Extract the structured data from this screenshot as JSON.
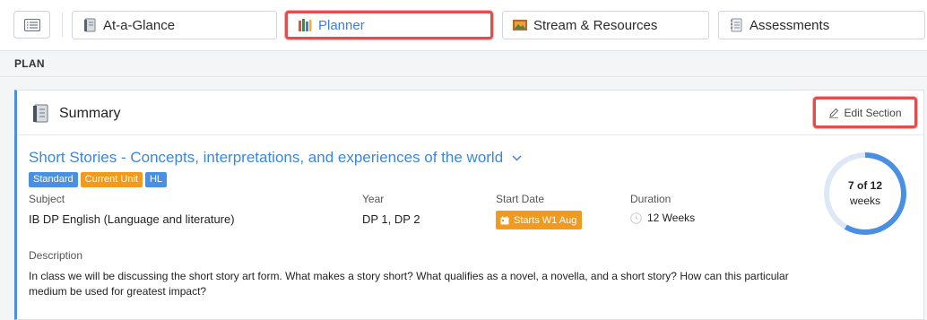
{
  "tabs": [
    {
      "label": "At-a-Glance",
      "icon": "book-icon"
    },
    {
      "label": "Planner",
      "icon": "books-icon"
    },
    {
      "label": "Stream & Resources",
      "icon": "painting-icon"
    },
    {
      "label": "Assessments",
      "icon": "notebook-icon"
    }
  ],
  "active_tab": "Planner",
  "section_label": "PLAN",
  "summary": {
    "title": "Summary",
    "edit_label": "Edit Section",
    "unit_title": "Short Stories - Concepts, interpretations, and experiences of the world",
    "badges": [
      "Standard",
      "Current Unit",
      "HL"
    ],
    "fields": {
      "subject_label": "Subject",
      "subject_value": "IB DP English (Language and literature)",
      "year_label": "Year",
      "year_value": "DP 1, DP 2",
      "start_label": "Start Date",
      "start_value": "Starts W1 Aug",
      "duration_label": "Duration",
      "duration_value": "12 Weeks"
    },
    "description_label": "Description",
    "description": "In class we will be discussing the short story art form. What makes a story short? What qualifies as a novel, a novella, and a short story? How can this particular medium be used for greatest impact?",
    "progress": {
      "text_top": "7 of 12",
      "text_bottom": "weeks",
      "fraction": 0.583
    }
  },
  "colors": {
    "accent": "#4a90e2",
    "highlight": "#e04f4f",
    "orange": "#f29a1f",
    "link": "#3f86d8"
  }
}
